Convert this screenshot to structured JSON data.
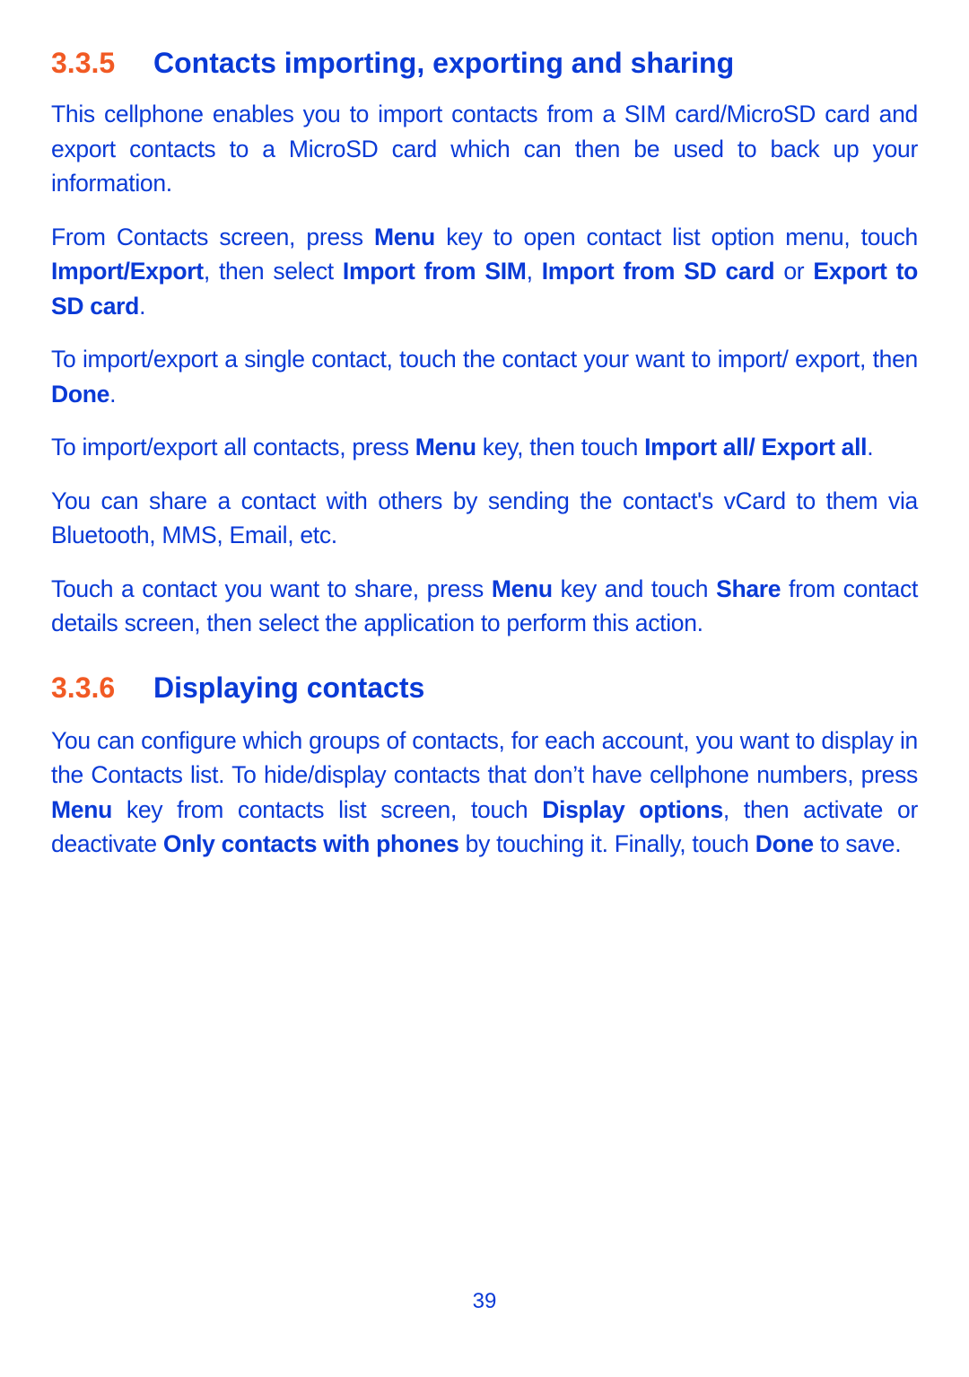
{
  "section1": {
    "number": "3.3.5",
    "title": "Contacts importing, exporting and sharing",
    "paragraphs": [
      [
        {
          "t": "This cellphone enables you to import contacts from a SIM card/MicroSD card and export contacts to a MicroSD card which can then be used to back up your information.",
          "b": false
        }
      ],
      [
        {
          "t": "From Contacts screen, press ",
          "b": false
        },
        {
          "t": "Menu",
          "b": true
        },
        {
          "t": " key to open contact list option menu, touch ",
          "b": false
        },
        {
          "t": "Import/Export",
          "b": true
        },
        {
          "t": ", then select ",
          "b": false
        },
        {
          "t": "Import from SIM",
          "b": true
        },
        {
          "t": ", ",
          "b": false
        },
        {
          "t": "Import from SD card",
          "b": true
        },
        {
          "t": " or ",
          "b": false
        },
        {
          "t": "Export to SD card",
          "b": true
        },
        {
          "t": ".",
          "b": false
        }
      ],
      [
        {
          "t": "To import/export a single contact, touch the contact your want to import/ export, then ",
          "b": false
        },
        {
          "t": "Done",
          "b": true
        },
        {
          "t": ".",
          "b": false
        }
      ],
      [
        {
          "t": "To import/export all contacts, press ",
          "b": false
        },
        {
          "t": "Menu",
          "b": true
        },
        {
          "t": " key, then touch ",
          "b": false
        },
        {
          "t": "Import all/ Export all",
          "b": true
        },
        {
          "t": ".",
          "b": false
        }
      ],
      [
        {
          "t": "You can share a contact with others by sending the contact's vCard to them via Bluetooth, MMS, Email, etc.",
          "b": false
        }
      ],
      [
        {
          "t": "Touch a contact you want to share, press ",
          "b": false
        },
        {
          "t": "Menu",
          "b": true
        },
        {
          "t": " key and touch ",
          "b": false
        },
        {
          "t": "Share",
          "b": true
        },
        {
          "t": " from contact details screen, then select the application to perform this action.",
          "b": false
        }
      ]
    ]
  },
  "section2": {
    "number": "3.3.6",
    "title": "Displaying contacts",
    "paragraphs": [
      [
        {
          "t": "You can configure which groups of contacts, for each account, you want to display in the Contacts list. To hide/display contacts that don’t have cellphone numbers, press ",
          "b": false
        },
        {
          "t": "Menu",
          "b": true
        },
        {
          "t": " key from contacts list screen, touch ",
          "b": false
        },
        {
          "t": "Display options",
          "b": true
        },
        {
          "t": ", then activate or deactivate ",
          "b": false
        },
        {
          "t": "Only contacts with phones",
          "b": true
        },
        {
          "t": " by touching it. Finally, touch ",
          "b": false
        },
        {
          "t": "Done",
          "b": true
        },
        {
          "t": " to save.",
          "b": false
        }
      ]
    ]
  },
  "footer": {
    "page_number": "39"
  },
  "colors": {
    "text": "#0a3ad6",
    "section_number": "#f15a24",
    "background": "#ffffff"
  }
}
